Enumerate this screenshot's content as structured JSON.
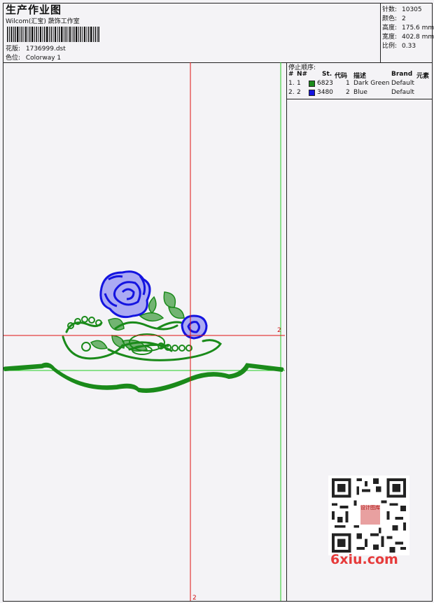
{
  "header": {
    "title": "生产作业图",
    "company": "Wilcom(汇宝) 蔬饰工作室",
    "design_label": "花版:",
    "design_value": "1736999.dst",
    "colorway_label": "色位:",
    "colorway_value": "Colorway 1",
    "stats": [
      {
        "label": "针数:",
        "value": "10305"
      },
      {
        "label": "颜色:",
        "value": "2"
      },
      {
        "label": "高度:",
        "value": "175.6 mm"
      },
      {
        "label": "宽度:",
        "value": "402.8 mm"
      },
      {
        "label": "比例:",
        "value": "0.33"
      }
    ]
  },
  "stop_sequence": {
    "title": "停止顺序:",
    "columns": [
      "#",
      "N#",
      "St.",
      "代码",
      "描述",
      "Brand",
      "元素"
    ],
    "rows": [
      {
        "num": "1.",
        "needle": "1",
        "color": "#1a8a1a",
        "stitches": "6823",
        "code": "1",
        "desc": "Dark Green",
        "brand": "Default"
      },
      {
        "num": "2.",
        "needle": "2",
        "color": "#1414e0",
        "stitches": "3480",
        "code": "2",
        "desc": "Blue",
        "brand": "Default"
      }
    ]
  },
  "axis_marks": {
    "horizontal": "2",
    "vertical": "2"
  },
  "watermark": {
    "logo_text": "设计图库",
    "site": "6xiu.com"
  },
  "colors": {
    "thread_green": "#1a8a1a",
    "thread_blue": "#1414e0",
    "crosshair_red": "#e01010",
    "guide_green": "#22cc22"
  }
}
